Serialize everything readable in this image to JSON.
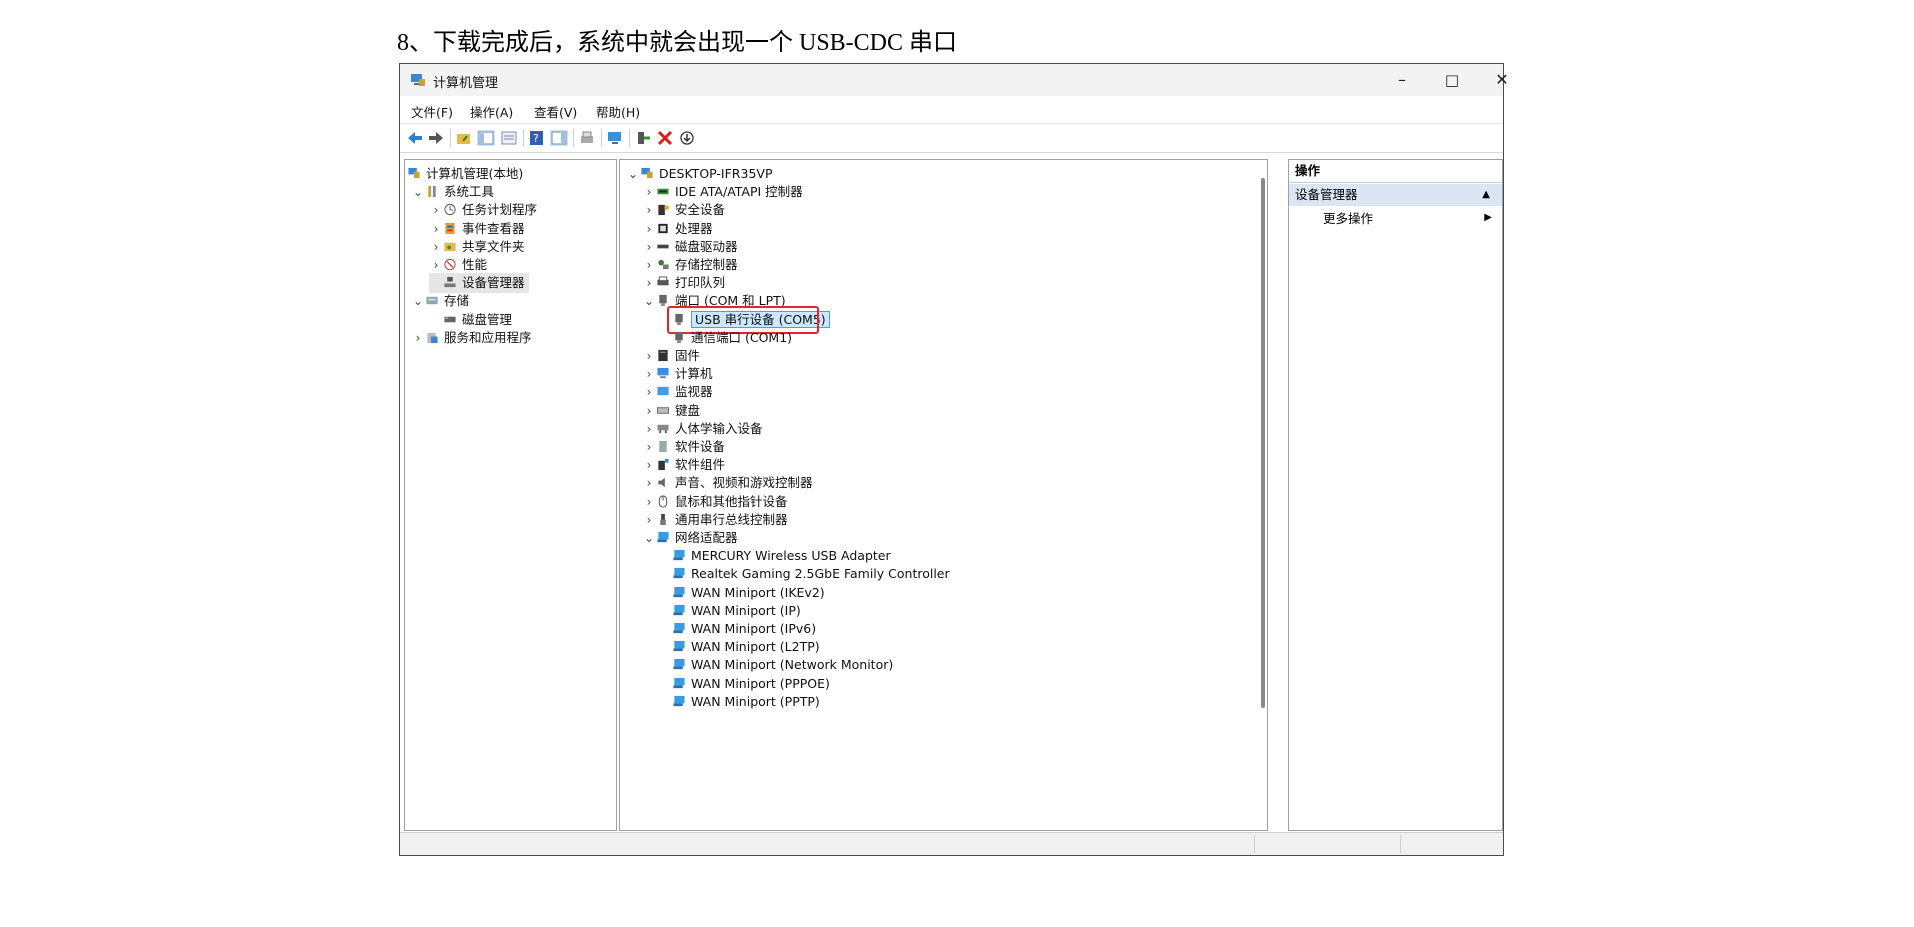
{
  "caption": "8、下载完成后，系统中就会出现一个 USB-CDC 串口",
  "window": {
    "title": "计算机管理",
    "controls": {
      "minimize": "–",
      "maximize": "□",
      "close": "✕"
    }
  },
  "menu": [
    "文件(F)",
    "操作(A)",
    "查看(V)",
    "帮助(H)"
  ],
  "left_tree": [
    {
      "label": "计算机管理(本地)",
      "icon": "computer-mgmt-icon"
    },
    {
      "label": "系统工具",
      "icon": "tools-icon",
      "chev": "⌄"
    },
    {
      "label": "任务计划程序",
      "icon": "clock-icon",
      "chev": "›"
    },
    {
      "label": "事件查看器",
      "icon": "event-viewer-icon",
      "chev": "›"
    },
    {
      "label": "共享文件夹",
      "icon": "shared-folder-icon",
      "chev": "›"
    },
    {
      "label": "性能",
      "icon": "performance-icon",
      "chev": "›"
    },
    {
      "label": "设备管理器",
      "icon": "device-manager-icon"
    },
    {
      "label": "存储",
      "icon": "storage-icon",
      "chev": "⌄"
    },
    {
      "label": "磁盘管理",
      "icon": "disk-mgmt-icon"
    },
    {
      "label": "服务和应用程序",
      "icon": "services-icon",
      "chev": "›"
    }
  ],
  "device_tree": {
    "root": "DESKTOP-IFR35VP",
    "items": [
      {
        "label": "IDE ATA/ATAPI 控制器",
        "icon": "ide-icon",
        "chev": "›",
        "level": 1
      },
      {
        "label": "安全设备",
        "icon": "security-icon",
        "chev": "›",
        "level": 1
      },
      {
        "label": "处理器",
        "icon": "cpu-icon",
        "chev": "›",
        "level": 1
      },
      {
        "label": "磁盘驱动器",
        "icon": "disk-icon",
        "chev": "›",
        "level": 1
      },
      {
        "label": "存储控制器",
        "icon": "storage-ctrl-icon",
        "chev": "›",
        "level": 1
      },
      {
        "label": "打印队列",
        "icon": "printer-icon",
        "chev": "›",
        "level": 1
      },
      {
        "label": "端口 (COM 和 LPT)",
        "icon": "port-icon",
        "chev": "⌄",
        "level": 1
      },
      {
        "label": "USB 串行设备 (COM5)",
        "icon": "port-icon",
        "chev": "",
        "level": 2,
        "selected": true
      },
      {
        "label": "通信端口 (COM1)",
        "icon": "port-icon",
        "chev": "",
        "level": 2
      },
      {
        "label": "固件",
        "icon": "firmware-icon",
        "chev": "›",
        "level": 1
      },
      {
        "label": "计算机",
        "icon": "monitor-icon",
        "chev": "›",
        "level": 1
      },
      {
        "label": "监视器",
        "icon": "display-icon",
        "chev": "›",
        "level": 1
      },
      {
        "label": "键盘",
        "icon": "keyboard-icon",
        "chev": "›",
        "level": 1
      },
      {
        "label": "人体学输入设备",
        "icon": "hid-icon",
        "chev": "›",
        "level": 1
      },
      {
        "label": "软件设备",
        "icon": "software-device-icon",
        "chev": "›",
        "level": 1
      },
      {
        "label": "软件组件",
        "icon": "software-component-icon",
        "chev": "›",
        "level": 1
      },
      {
        "label": "声音、视频和游戏控制器",
        "icon": "sound-icon",
        "chev": "›",
        "level": 1
      },
      {
        "label": "鼠标和其他指针设备",
        "icon": "mouse-icon",
        "chev": "›",
        "level": 1
      },
      {
        "label": "通用串行总线控制器",
        "icon": "usb-icon",
        "chev": "›",
        "level": 1
      },
      {
        "label": "网络适配器",
        "icon": "network-icon",
        "chev": "⌄",
        "level": 1
      },
      {
        "label": "MERCURY Wireless USB Adapter",
        "icon": "network-icon",
        "chev": "",
        "level": 2
      },
      {
        "label": "Realtek Gaming 2.5GbE Family Controller",
        "icon": "network-icon",
        "chev": "",
        "level": 2
      },
      {
        "label": "WAN Miniport (IKEv2)",
        "icon": "network-icon",
        "chev": "",
        "level": 2
      },
      {
        "label": "WAN Miniport (IP)",
        "icon": "network-icon",
        "chev": "",
        "level": 2
      },
      {
        "label": "WAN Miniport (IPv6)",
        "icon": "network-icon",
        "chev": "",
        "level": 2
      },
      {
        "label": "WAN Miniport (L2TP)",
        "icon": "network-icon",
        "chev": "",
        "level": 2
      },
      {
        "label": "WAN Miniport (Network Monitor)",
        "icon": "network-icon",
        "chev": "",
        "level": 2
      },
      {
        "label": "WAN Miniport (PPPOE)",
        "icon": "network-icon",
        "chev": "",
        "level": 2
      },
      {
        "label": "WAN Miniport (PPTP)",
        "icon": "network-icon",
        "chev": "",
        "level": 2
      }
    ]
  },
  "actions": {
    "header": "操作",
    "section": "设备管理器",
    "more": "更多操作"
  },
  "colors": {
    "highlight": "#e5252a",
    "selection": "#cce8ff",
    "actions_header_bg": "#dbe6f4"
  }
}
